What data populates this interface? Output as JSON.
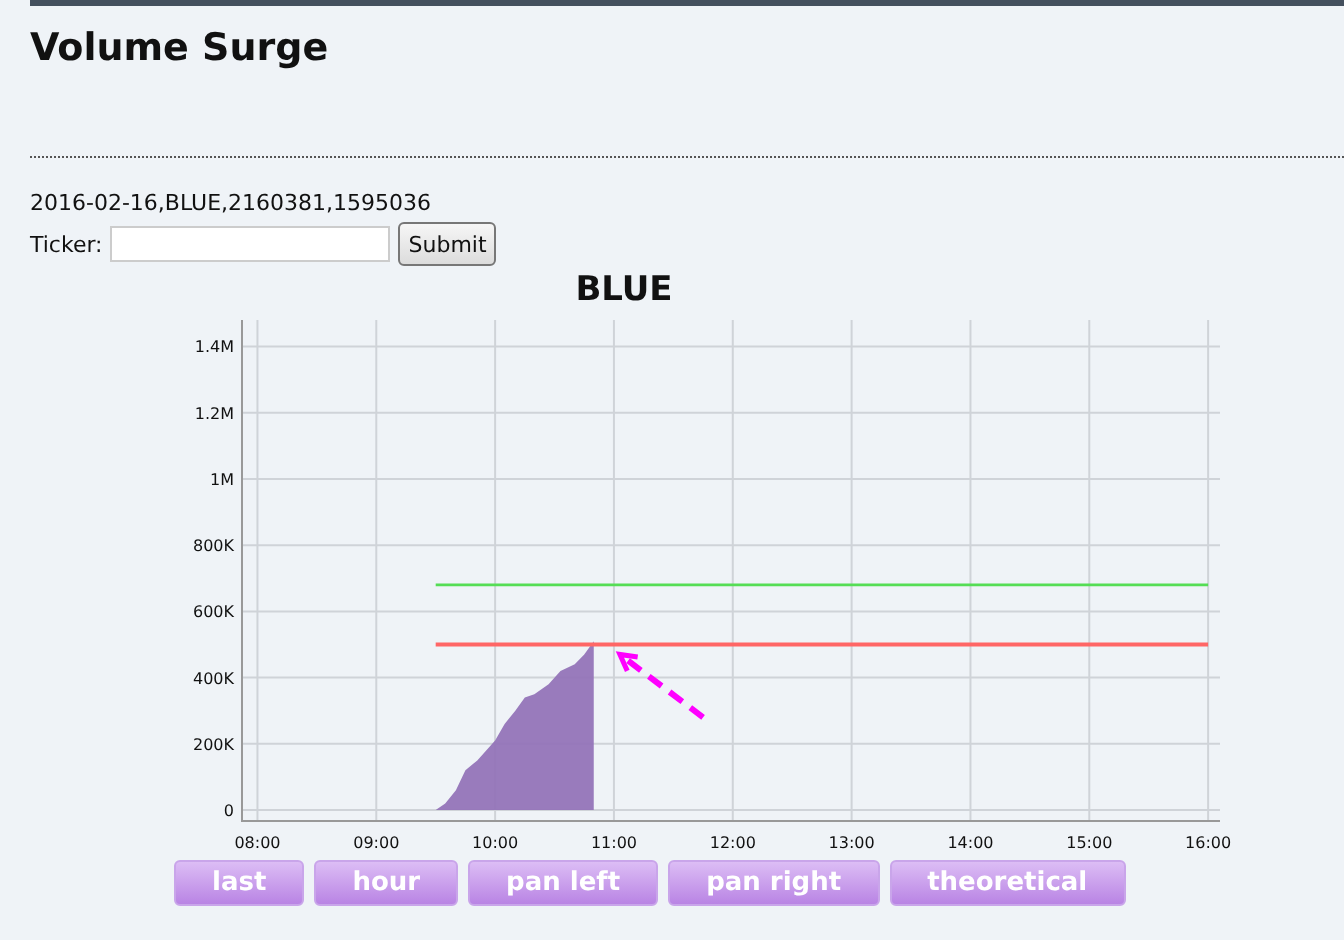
{
  "page_title": "Volume Surge",
  "data_line": "2016-02-16,BLUE,2160381,1595036",
  "ticker_form": {
    "label": "Ticker:",
    "submit": "Submit"
  },
  "chart_data": {
    "type": "area",
    "title": "BLUE",
    "x": [
      9.5,
      9.58,
      9.67,
      9.75,
      9.85,
      10,
      10.08,
      10.17,
      10.25,
      10.33,
      10.45,
      10.55,
      10.67,
      10.75,
      10.83,
      16
    ],
    "series": [
      {
        "color": "#9474b8",
        "values": [
          0,
          20000,
          60000,
          120000,
          150000,
          210000,
          260000,
          300000,
          340000,
          350000,
          380000,
          420000,
          440000,
          470000,
          510000,
          null
        ]
      },
      {
        "type": "line",
        "color": "#55dd55",
        "values": [
          680000,
          680000,
          680000,
          680000,
          680000,
          680000,
          680000,
          680000,
          680000,
          680000,
          680000,
          680000,
          680000,
          680000,
          680000,
          680000
        ]
      },
      {
        "type": "line",
        "color": "#ff6666",
        "values": [
          500000,
          500000,
          500000,
          500000,
          500000,
          500000,
          500000,
          500000,
          500000,
          500000,
          500000,
          500000,
          500000,
          500000,
          500000,
          500000
        ]
      }
    ],
    "grid": true,
    "xlim": [
      7.87,
      16.1
    ],
    "ylim": [
      -30000,
      1480000
    ],
    "xticks": [
      {
        "value": 8,
        "label": "08:00"
      },
      {
        "value": 9,
        "label": "09:00"
      },
      {
        "value": 10,
        "label": "10:00"
      },
      {
        "value": 11,
        "label": "11:00"
      },
      {
        "value": 12,
        "label": "12:00"
      },
      {
        "value": 13,
        "label": "13:00"
      },
      {
        "value": 14,
        "label": "14:00"
      },
      {
        "value": 15,
        "label": "15:00"
      },
      {
        "value": 16,
        "label": "16:00"
      }
    ],
    "yticks": [
      {
        "value": 0,
        "label": "0"
      },
      {
        "value": 200000,
        "label": "200K"
      },
      {
        "value": 400000,
        "label": "400K"
      },
      {
        "value": 600000,
        "label": "600K"
      },
      {
        "value": 800000,
        "label": "800K"
      },
      {
        "value": 1000000,
        "label": "1M"
      },
      {
        "value": 1200000,
        "label": "1.2M"
      },
      {
        "value": 1400000,
        "label": "1.4M"
      }
    ]
  },
  "buttons": [
    "last",
    "hour",
    "pan left",
    "pan right",
    "theoretical"
  ]
}
